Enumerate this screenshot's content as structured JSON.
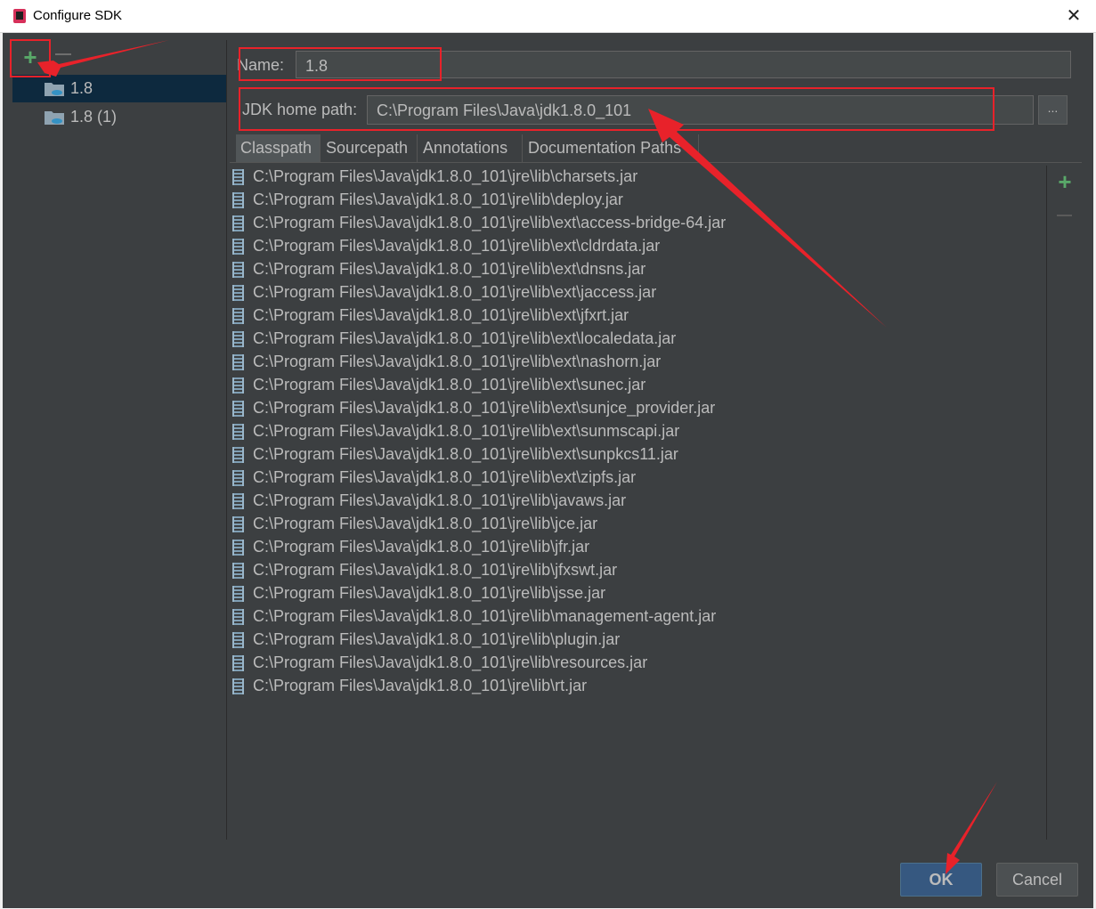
{
  "window": {
    "title": "Configure SDK",
    "close_glyph": "✕"
  },
  "sdk_list": {
    "items": [
      {
        "label": "1.8",
        "selected": true
      },
      {
        "label": "1.8 (1)",
        "selected": false
      }
    ]
  },
  "form": {
    "name_label": "Name:",
    "name_value": "1.8",
    "jdk_label": "JDK home path:",
    "jdk_value": "C:\\Program Files\\Java\\jdk1.8.0_101",
    "browse_label": "..."
  },
  "tabs": [
    {
      "label": "Classpath",
      "active": true
    },
    {
      "label": "Sourcepath",
      "active": false
    },
    {
      "label": "Annotations",
      "active": false
    },
    {
      "label": "Documentation Paths",
      "active": false
    }
  ],
  "classpath": [
    "C:\\Program Files\\Java\\jdk1.8.0_101\\jre\\lib\\charsets.jar",
    "C:\\Program Files\\Java\\jdk1.8.0_101\\jre\\lib\\deploy.jar",
    "C:\\Program Files\\Java\\jdk1.8.0_101\\jre\\lib\\ext\\access-bridge-64.jar",
    "C:\\Program Files\\Java\\jdk1.8.0_101\\jre\\lib\\ext\\cldrdata.jar",
    "C:\\Program Files\\Java\\jdk1.8.0_101\\jre\\lib\\ext\\dnsns.jar",
    "C:\\Program Files\\Java\\jdk1.8.0_101\\jre\\lib\\ext\\jaccess.jar",
    "C:\\Program Files\\Java\\jdk1.8.0_101\\jre\\lib\\ext\\jfxrt.jar",
    "C:\\Program Files\\Java\\jdk1.8.0_101\\jre\\lib\\ext\\localedata.jar",
    "C:\\Program Files\\Java\\jdk1.8.0_101\\jre\\lib\\ext\\nashorn.jar",
    "C:\\Program Files\\Java\\jdk1.8.0_101\\jre\\lib\\ext\\sunec.jar",
    "C:\\Program Files\\Java\\jdk1.8.0_101\\jre\\lib\\ext\\sunjce_provider.jar",
    "C:\\Program Files\\Java\\jdk1.8.0_101\\jre\\lib\\ext\\sunmscapi.jar",
    "C:\\Program Files\\Java\\jdk1.8.0_101\\jre\\lib\\ext\\sunpkcs11.jar",
    "C:\\Program Files\\Java\\jdk1.8.0_101\\jre\\lib\\ext\\zipfs.jar",
    "C:\\Program Files\\Java\\jdk1.8.0_101\\jre\\lib\\javaws.jar",
    "C:\\Program Files\\Java\\jdk1.8.0_101\\jre\\lib\\jce.jar",
    "C:\\Program Files\\Java\\jdk1.8.0_101\\jre\\lib\\jfr.jar",
    "C:\\Program Files\\Java\\jdk1.8.0_101\\jre\\lib\\jfxswt.jar",
    "C:\\Program Files\\Java\\jdk1.8.0_101\\jre\\lib\\jsse.jar",
    "C:\\Program Files\\Java\\jdk1.8.0_101\\jre\\lib\\management-agent.jar",
    "C:\\Program Files\\Java\\jdk1.8.0_101\\jre\\lib\\plugin.jar",
    "C:\\Program Files\\Java\\jdk1.8.0_101\\jre\\lib\\resources.jar",
    "C:\\Program Files\\Java\\jdk1.8.0_101\\jre\\lib\\rt.jar"
  ],
  "buttons": {
    "ok": "OK",
    "cancel": "Cancel"
  },
  "icons": {
    "add": "plus-icon",
    "remove": "minus-icon",
    "jar": "jar-archive-icon",
    "folder": "sdk-folder-icon"
  },
  "colors": {
    "background": "#3c3f41",
    "selection": "#0d293e",
    "ok_button": "#365880",
    "add_green": "#59a869",
    "annotation_red": "#e8222a"
  }
}
